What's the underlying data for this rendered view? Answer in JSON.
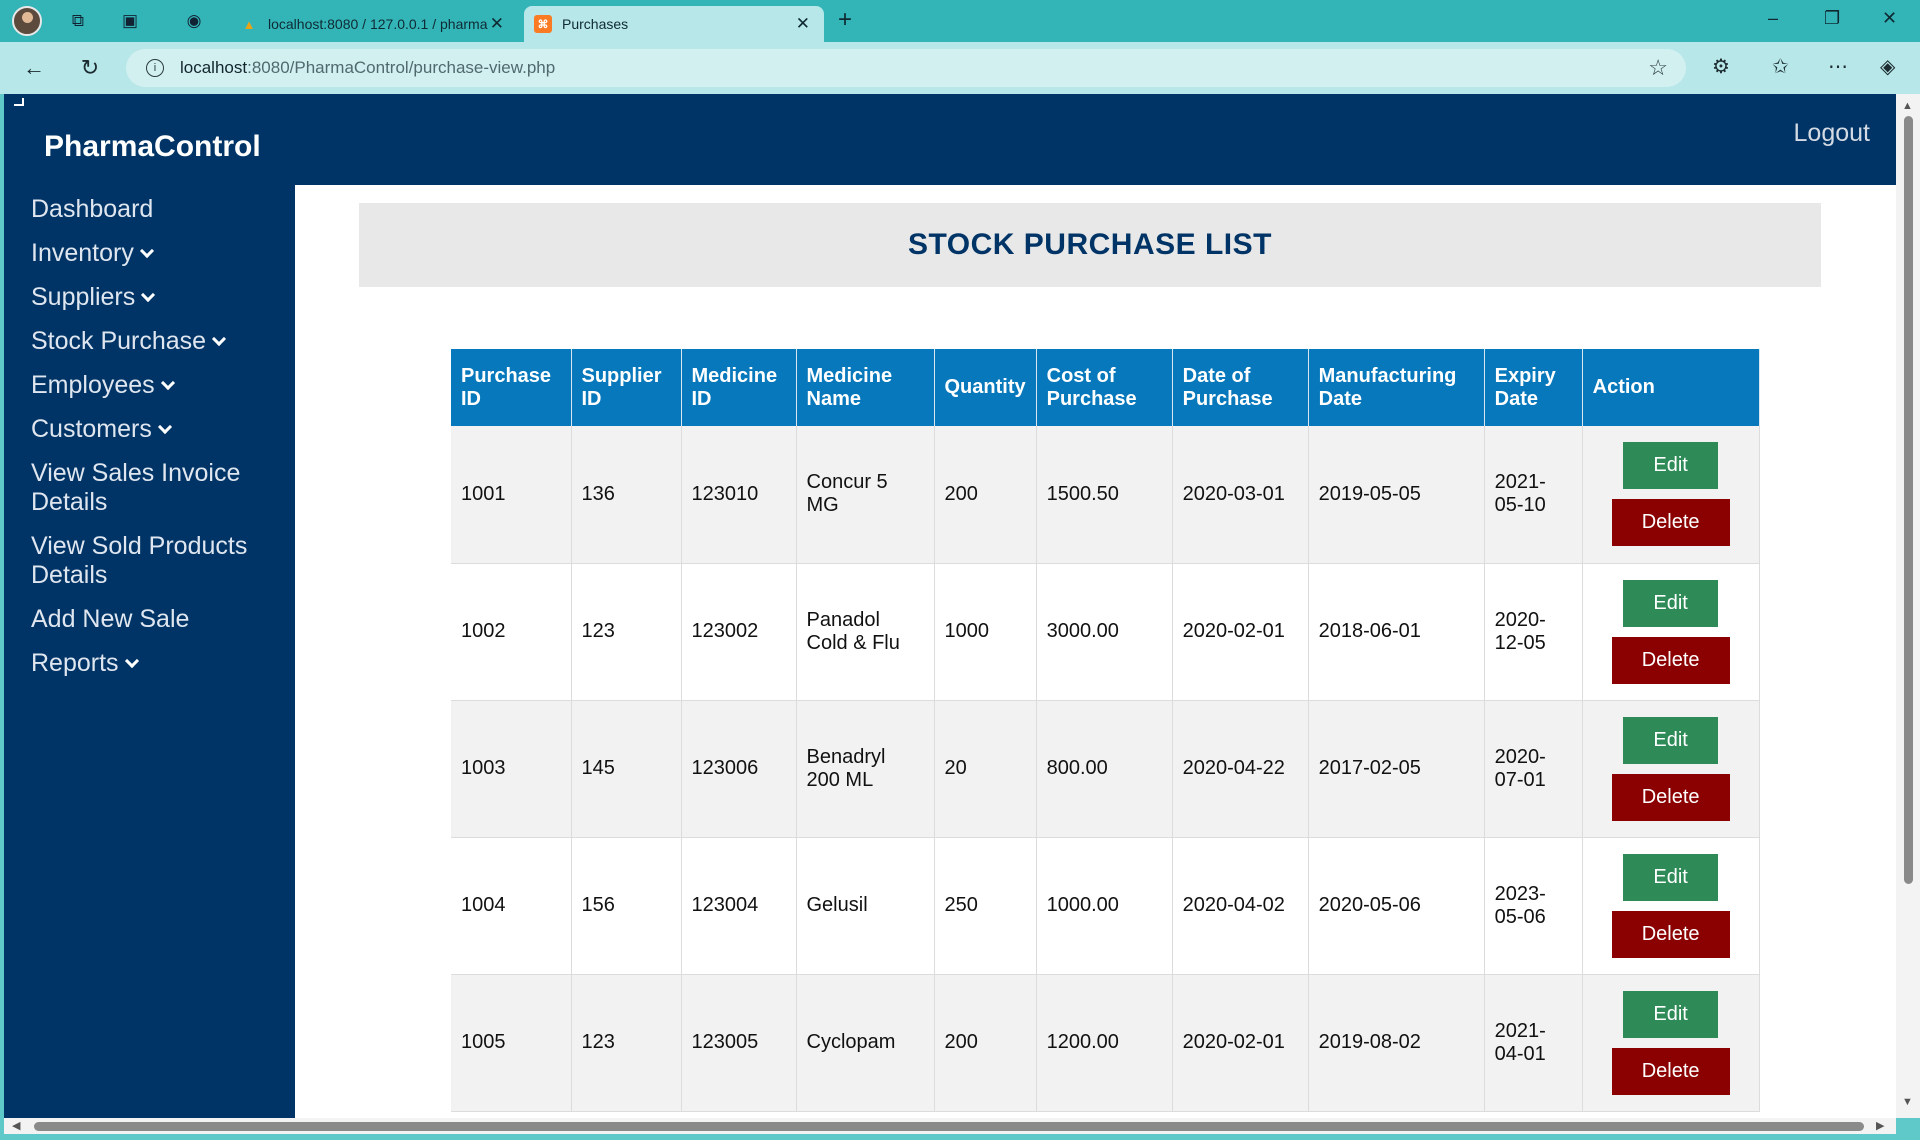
{
  "browser": {
    "tabs": [
      {
        "title": "localhost:8080 / 127.0.0.1 / pharmacy",
        "active": false
      },
      {
        "title": "Purchases",
        "active": true
      }
    ],
    "url_host": "localhost",
    "url_rest": ":8080/PharmaControl/purchase-view.php"
  },
  "header": {
    "brand": "PharmaControl",
    "logout": "Logout"
  },
  "sidebar": {
    "items": [
      {
        "label": "Dashboard",
        "dropdown": false
      },
      {
        "label": "Inventory",
        "dropdown": true
      },
      {
        "label": "Suppliers",
        "dropdown": true
      },
      {
        "label": "Stock Purchase",
        "dropdown": true
      },
      {
        "label": "Employees",
        "dropdown": true
      },
      {
        "label": "Customers",
        "dropdown": true
      },
      {
        "label": "View Sales Invoice Details",
        "dropdown": false
      },
      {
        "label": "View Sold Products Details",
        "dropdown": false
      },
      {
        "label": "Add New Sale",
        "dropdown": false
      },
      {
        "label": "Reports",
        "dropdown": true
      }
    ]
  },
  "main": {
    "title": "STOCK PURCHASE LIST",
    "columns": [
      "Purchase ID",
      "Supplier ID",
      "Medicine ID",
      "Medicine Name",
      "Quantity",
      "Cost of Purchase",
      "Date of Purchase",
      "Manufacturing Date",
      "Expiry Date",
      "Action"
    ],
    "rows": [
      [
        "1001",
        "136",
        "123010",
        "Concur 5 MG",
        "200",
        "1500.50",
        "2020-03-01",
        "2019-05-05",
        "2021-05-10"
      ],
      [
        "1002",
        "123",
        "123002",
        "Panadol Cold & Flu",
        "1000",
        "3000.00",
        "2020-02-01",
        "2018-06-01",
        "2020-12-05"
      ],
      [
        "1003",
        "145",
        "123006",
        "Benadryl 200 ML",
        "20",
        "800.00",
        "2020-04-22",
        "2017-02-05",
        "2020-07-01"
      ],
      [
        "1004",
        "156",
        "123004",
        "Gelusil",
        "250",
        "1000.00",
        "2020-04-02",
        "2020-05-06",
        "2023-05-06"
      ],
      [
        "1005",
        "123",
        "123005",
        "Cyclopam",
        "200",
        "1200.00",
        "2020-02-01",
        "2019-08-02",
        "2021-04-01"
      ]
    ],
    "edit_label": "Edit",
    "delete_label": "Delete"
  },
  "colors": {
    "navy": "#003466",
    "table_header": "#0778bb",
    "edit_button": "#2e8b57",
    "delete_button": "#8b0000"
  }
}
